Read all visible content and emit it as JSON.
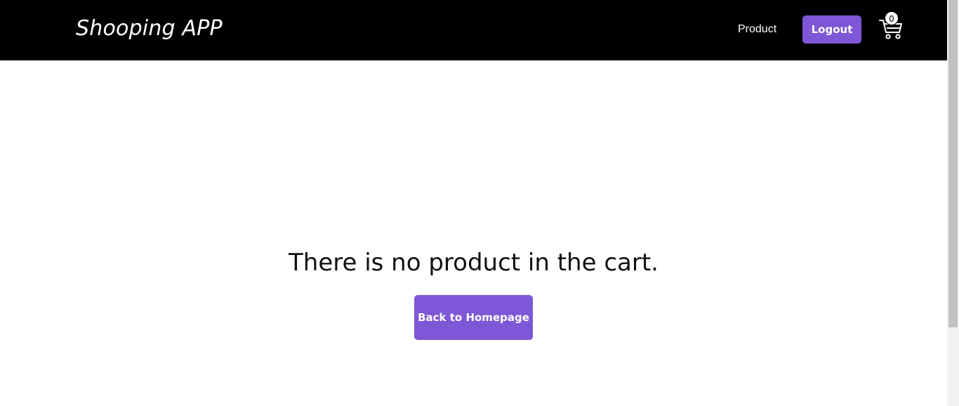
{
  "header": {
    "brand": "Shooping APP",
    "nav_product": "Product",
    "logout_label": "Logout",
    "cart_icon": "shopping-cart-icon",
    "cart_count": "0"
  },
  "main": {
    "empty_message": "There is no product in the cart.",
    "back_button_label": "Back to Homepage"
  },
  "colors": {
    "navbar_bg": "#000000",
    "accent": "#7e57d6",
    "page_bg": "#ffffff"
  }
}
